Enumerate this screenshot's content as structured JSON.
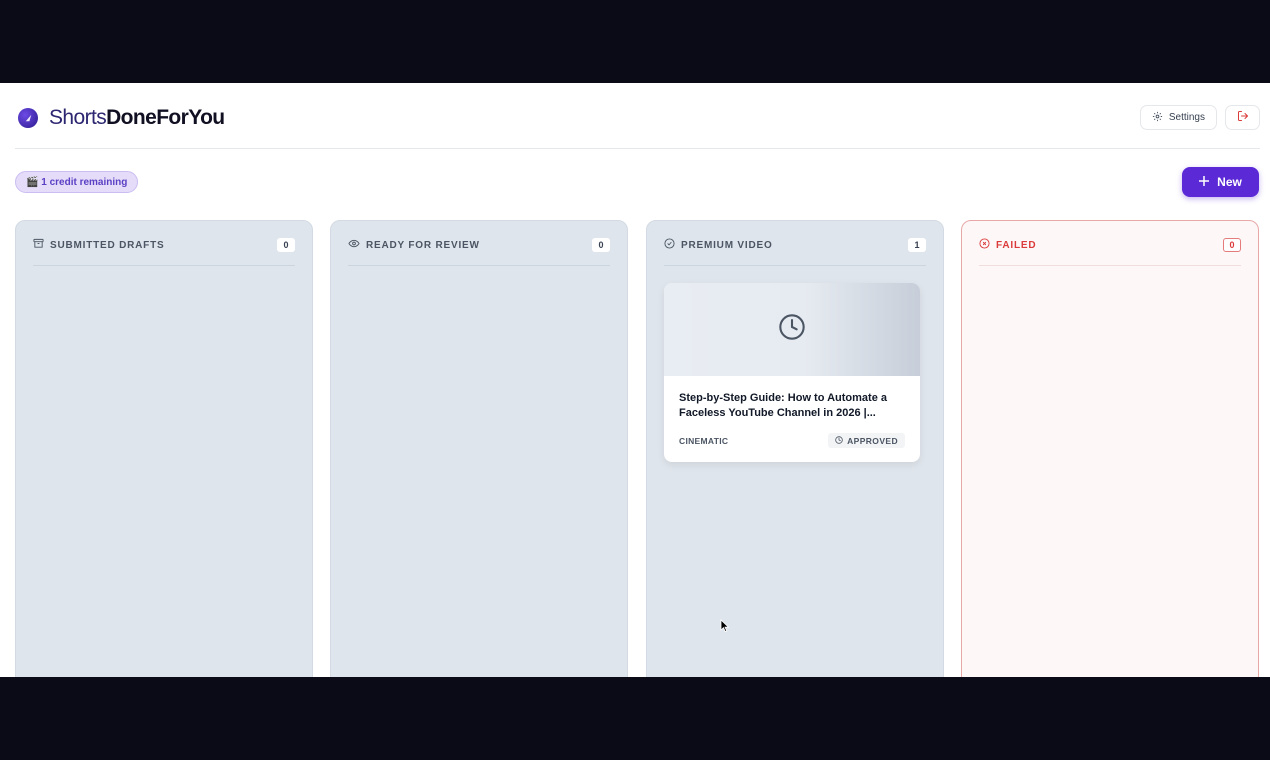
{
  "brand": {
    "name_light": "Shorts",
    "name_bold": "DoneForYou"
  },
  "header": {
    "settings_label": "Settings"
  },
  "toolbar": {
    "credits_label": "🎬 1 credit remaining",
    "new_label": "New"
  },
  "columns": [
    {
      "title": "SUBMITTED DRAFTS",
      "count": "0",
      "icon": "archive-icon"
    },
    {
      "title": "READY FOR REVIEW",
      "count": "0",
      "icon": "eye-icon"
    },
    {
      "title": "PREMIUM VIDEO",
      "count": "1",
      "icon": "check-circle-icon"
    },
    {
      "title": "FAILED",
      "count": "0",
      "icon": "x-circle-icon"
    }
  ],
  "card": {
    "title": "Step-by-Step Guide: How to Automate a Faceless YouTube Channel in 2026 |...",
    "style": "CINEMATIC",
    "status": "APPROVED",
    "thumbnail_icon": "clock-icon"
  },
  "colors": {
    "accent": "#5b2ad6",
    "failed": "#dc3b3b",
    "column_bg": "#dfe5ec",
    "credit_badge_bg": "#e4dcf8"
  }
}
